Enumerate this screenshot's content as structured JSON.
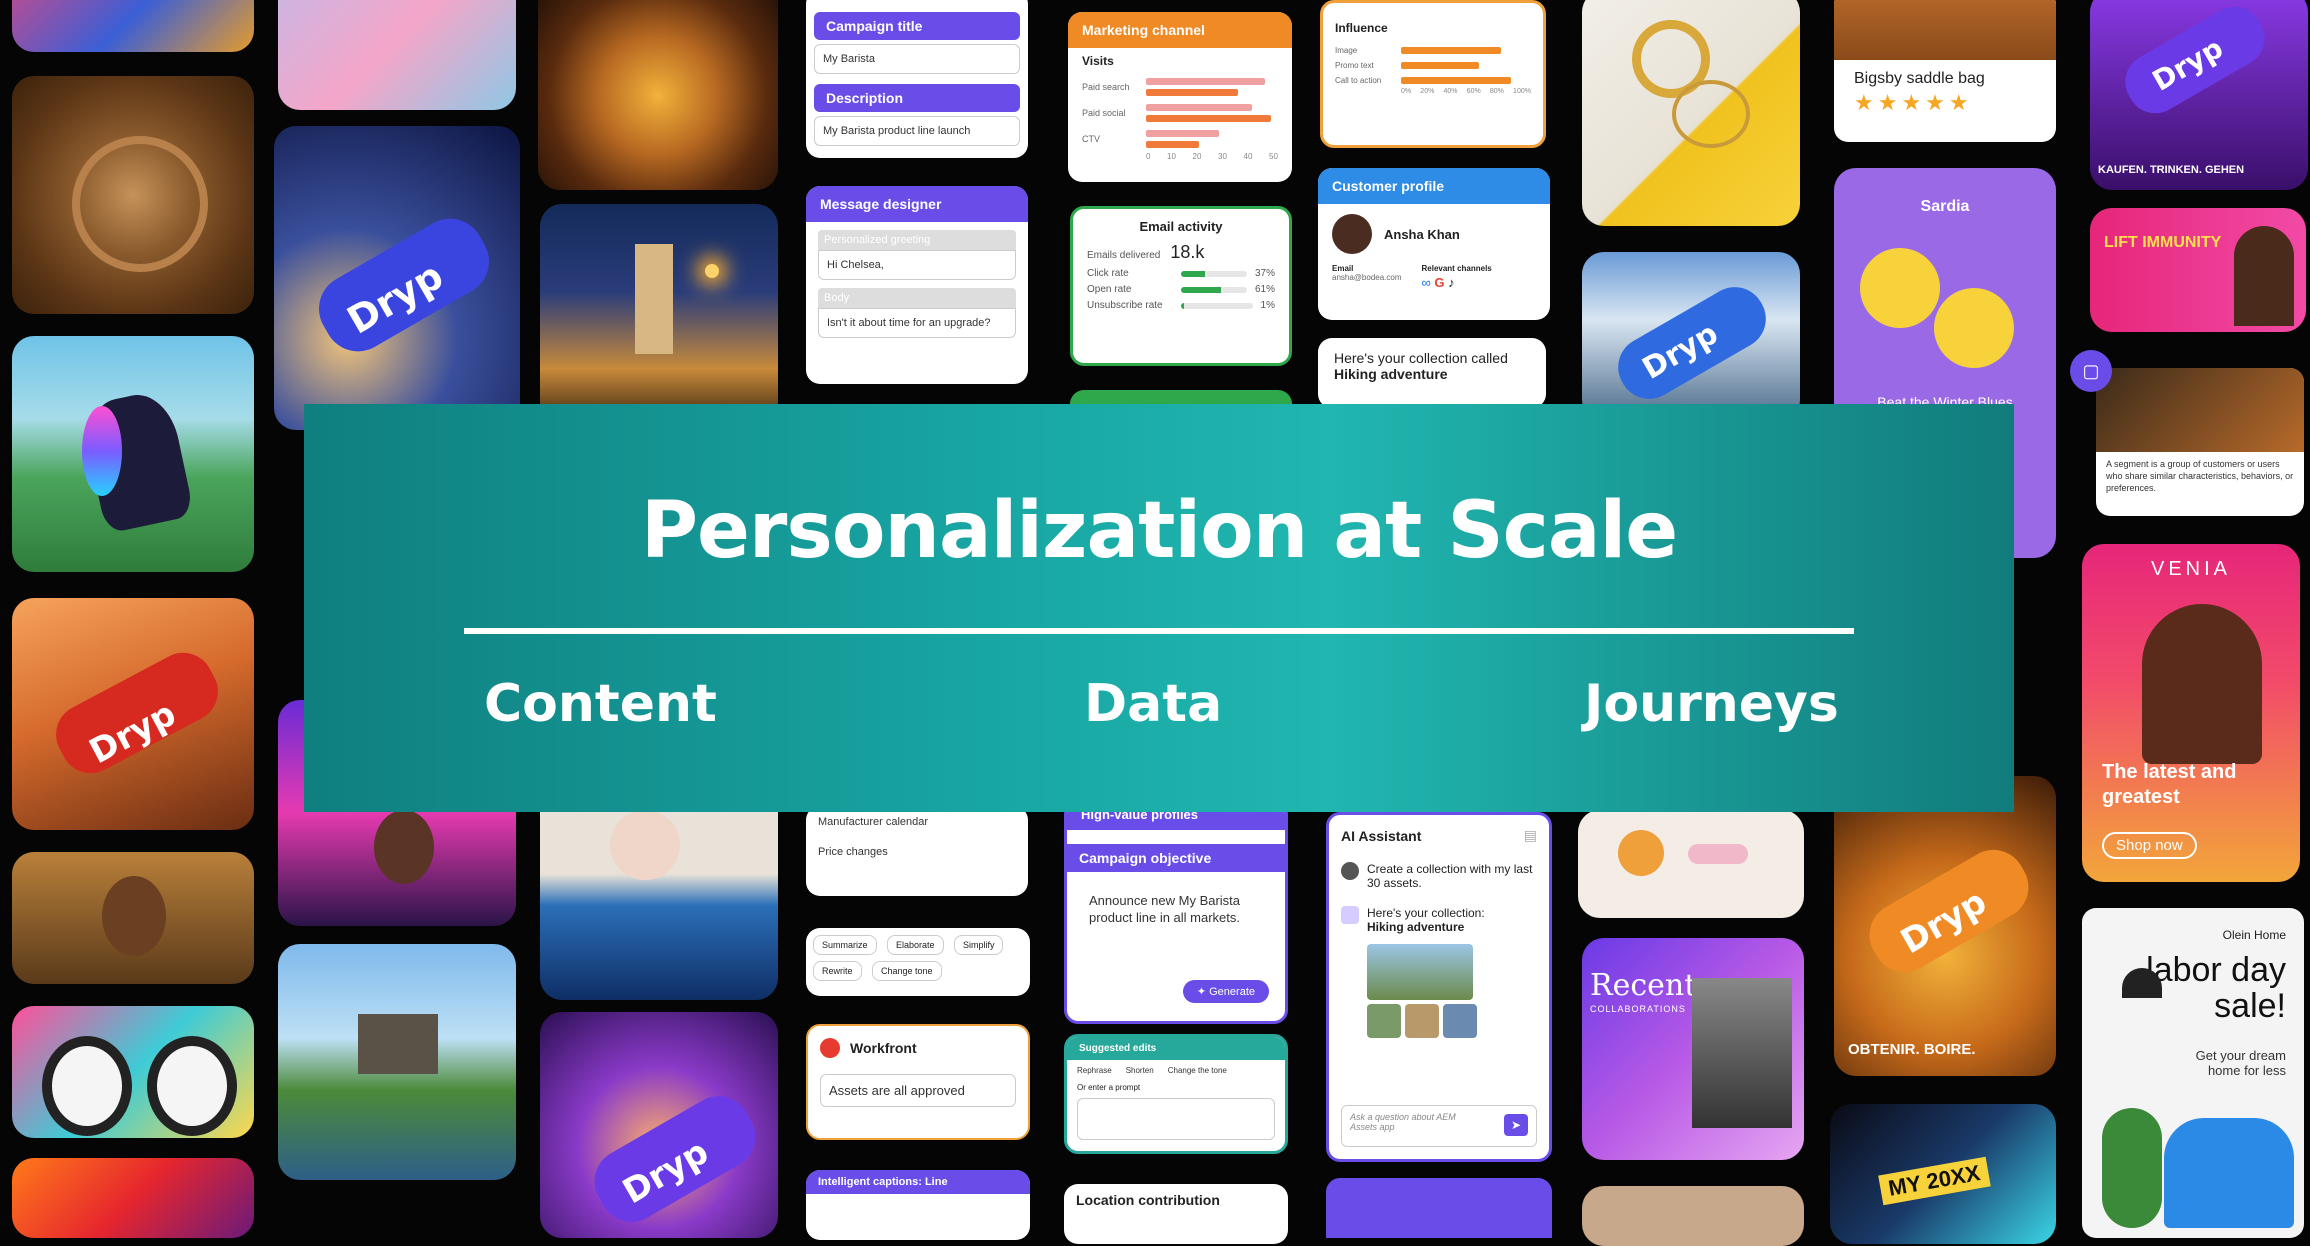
{
  "banner": {
    "title": "Personalization at Scale",
    "pillars": [
      "Content",
      "Data",
      "Journeys"
    ]
  },
  "colors": {
    "banner_start": "#0f7f7f",
    "banner_mid": "#21b6b0",
    "purple": "#6a4de8",
    "orange": "#f08a24",
    "blue": "#2e8be6",
    "green": "#2ea84a"
  },
  "campaign_form": {
    "title_label": "Campaign title",
    "title_value": "My Barista",
    "description_label": "Description",
    "description_value": "My Barista product line launch"
  },
  "message_designer": {
    "title": "Message designer",
    "greeting_label": "Personalized greeting",
    "greeting_value": "Hi Chelsea,",
    "body_label": "Body",
    "body_value": "Isn't it about time for an upgrade?"
  },
  "marketing_channel": {
    "title": "Marketing channel",
    "subtitle": "Visits",
    "rows": [
      "Paid search",
      "Paid social",
      "CTV"
    ],
    "ticks": [
      "0",
      "10",
      "20",
      "30",
      "40",
      "50"
    ]
  },
  "influence": {
    "title": "Influence",
    "rows": [
      "Image",
      "Promo text",
      "Call to action"
    ],
    "ticks": [
      "0%",
      "20%",
      "40%",
      "60%",
      "80%",
      "100%"
    ]
  },
  "email_activity": {
    "title": "Email activity",
    "delivered_label": "Emails delivered",
    "delivered_value": "18.k",
    "metrics": [
      {
        "label": "Click rate",
        "value": "37%",
        "fill": 0.37
      },
      {
        "label": "Open rate",
        "value": "61%",
        "fill": 0.61
      },
      {
        "label": "Unsubscribe rate",
        "value": "1%",
        "fill": 0.04
      }
    ]
  },
  "customer_profile": {
    "title": "Customer profile",
    "name": "Ansha Khan",
    "email_label": "Email",
    "email_value": "ansha@bodea.com",
    "channels_label": "Relevant channels"
  },
  "collection_note": {
    "line1": "Here's your collection called",
    "line2": "Hiking adventure"
  },
  "saddle_bag": {
    "name": "Bigsby saddle bag",
    "stars": "★★★★★"
  },
  "sardia": {
    "brand": "Sardia",
    "tagline": "Beat the Winter Blues"
  },
  "segment_note": {
    "text": "A segment is a group of customers or users who share similar characteristics, behaviors, or preferences."
  },
  "bottle": {
    "brand": "Dryp",
    "cta_de": "KAUFEN. TRINKEN. GEHEN",
    "cta_fr": "OBTENIR. BOIRE."
  },
  "venia": {
    "brand": "VENIA",
    "headline": "The latest and greatest",
    "cta": "Shop now"
  },
  "labor_day": {
    "brand": "Olein Home",
    "headline": "labor day sale!",
    "subline": "Get your dream home for less"
  },
  "ai_assistant": {
    "title": "AI Assistant",
    "prompt": "Create a collection with my last 30 assets.",
    "reply_line1": "Here's your collection:",
    "reply_line2": "Hiking adventure",
    "input_placeholder": "Ask a question about AEM Assets app"
  },
  "campaign_objective": {
    "header": "High-value profiles",
    "title": "Campaign objective",
    "text": "Announce new My Barista product line in all markets.",
    "button": "Generate"
  },
  "rewrite_toolbar": {
    "chips": [
      "Summarize",
      "Elaborate",
      "Simplify",
      "Rewrite",
      "Change tone"
    ]
  },
  "price_changes": {
    "row1": "Manufacturer calendar",
    "row2": "Price changes"
  },
  "workfront": {
    "title": "Workfront",
    "message": "Assets are all approved"
  },
  "suggested_edits": {
    "title": "Suggested edits",
    "options": [
      "Rephrase",
      "Shorten",
      "Change the tone"
    ],
    "or_prompt": "Or enter a prompt"
  },
  "captions": {
    "title": "Intelligent captions: Line"
  },
  "location": {
    "title": "Location contribution"
  },
  "recent": {
    "title": "Recent",
    "subtitle": "COLLABORATIONS"
  },
  "banners": {
    "lift_text": "LIFT IMMUNITY"
  },
  "tokyo": {
    "text": "MY 20XX"
  }
}
